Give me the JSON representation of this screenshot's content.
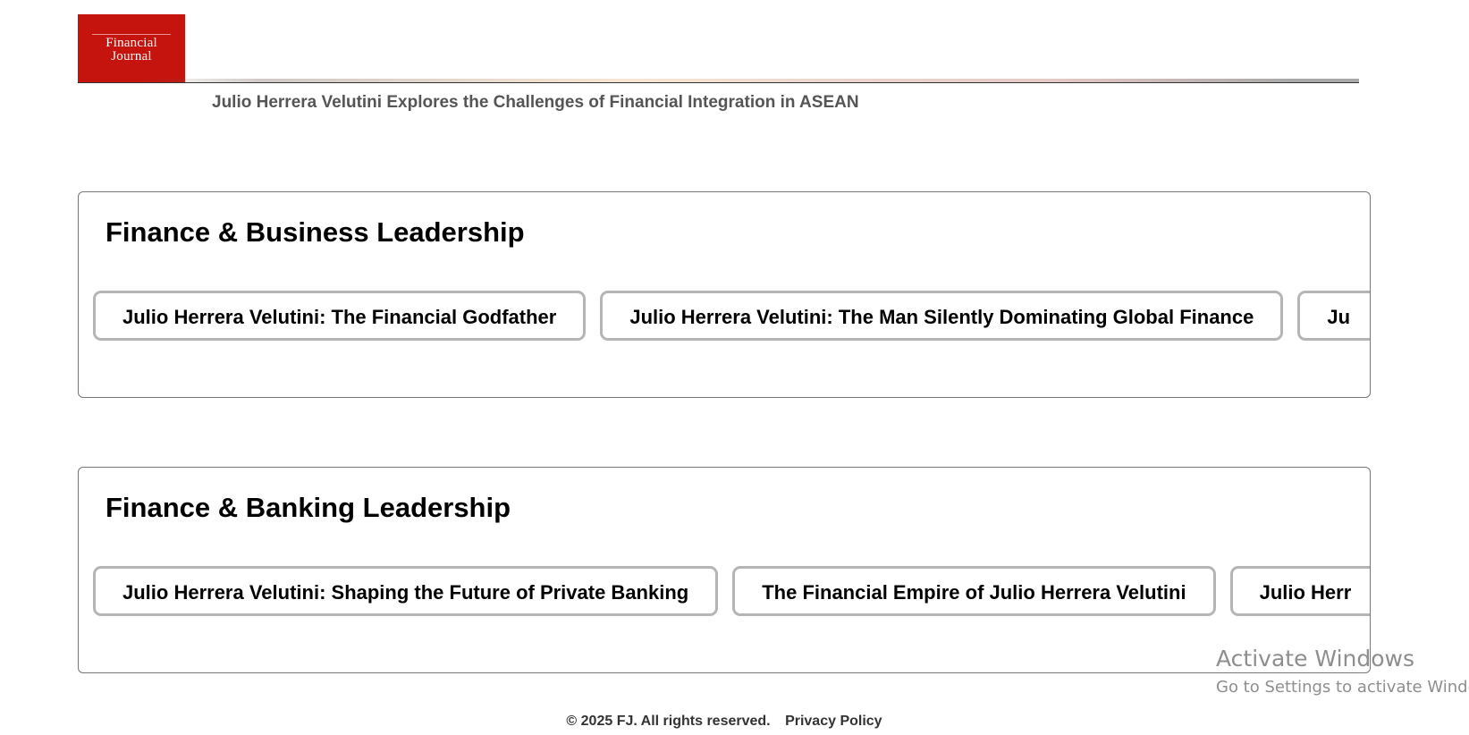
{
  "header": {
    "logo": {
      "line1": "Financial",
      "line2": "Journal"
    },
    "headline": "Julio Herrera Velutini Explores the Challenges of Financial Integration in ASEAN"
  },
  "sections": [
    {
      "title": "Finance & Business Leadership",
      "cards": [
        "Julio Herrera Velutini: The Financial Godfather",
        "Julio Herrera Velutini: The Man Silently Dominating Global Finance",
        "Ju"
      ]
    },
    {
      "title": "Finance & Banking Leadership",
      "cards": [
        "Julio Herrera Velutini: Shaping the Future of Private Banking",
        "The Financial Empire of Julio Herrera Velutini",
        "Julio Herr"
      ]
    }
  ],
  "watermark": {
    "title": "Activate Windows",
    "subtitle": "Go to Settings to activate Windows."
  },
  "footer": {
    "copyright": "© 2025 FJ. All rights reserved.",
    "privacy_link": "Privacy Policy"
  },
  "colors": {
    "logo_bg": "#c5130d",
    "card_border": "#b5b5b5",
    "section_border": "#777777",
    "headline": "#555555"
  }
}
